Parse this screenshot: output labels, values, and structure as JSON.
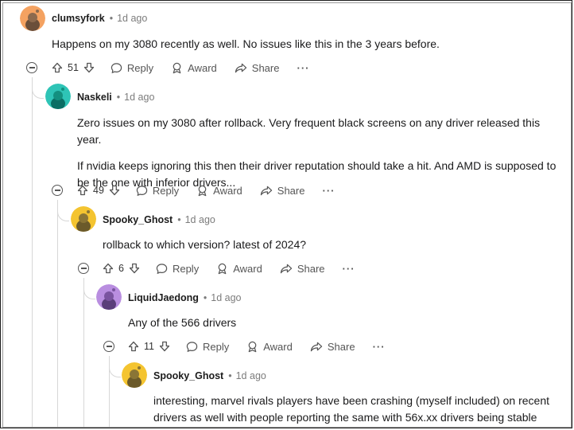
{
  "comments": [
    {
      "author": "clumsyfork",
      "time": "1d ago",
      "avatar_color": "#f4a261",
      "body": [
        "Happens on my 3080 recently as well. No issues like this in the 3 years before."
      ],
      "votes": "51"
    },
    {
      "author": "Naskeli",
      "time": "1d ago",
      "avatar_color": "#2ec4b6",
      "body": [
        "Zero issues on my 3080 after rollback. Very frequent black screens on any driver released this year.",
        "If nvidia keeps ignoring this then their driver reputation should take a hit. And AMD is supposed to be the one with inferior drivers..."
      ],
      "votes": "49"
    },
    {
      "author": "Spooky_Ghost",
      "time": "1d ago",
      "avatar_color": "#f4c430",
      "body": [
        "rollback to which version? latest of 2024?"
      ],
      "votes": "6"
    },
    {
      "author": "LiquidJaedong",
      "time": "1d ago",
      "avatar_color": "#b98ee0",
      "body": [
        "Any of the 566 drivers"
      ],
      "votes": "11"
    },
    {
      "author": "Spooky_Ghost",
      "time": "1d ago",
      "avatar_color": "#f4c430",
      "body": [
        "interesting, marvel rivals players have been crashing (myself included) on recent drivers as well with people reporting the same with 56x.xx drivers being stable"
      ],
      "votes": ""
    }
  ],
  "actions": {
    "reply": "Reply",
    "award": "Award",
    "share": "Share",
    "more": "···"
  },
  "separator": "•",
  "icons": [
    "upvote-icon",
    "downvote-icon",
    "reply-icon",
    "award-icon",
    "share-icon",
    "collapse-icon"
  ]
}
